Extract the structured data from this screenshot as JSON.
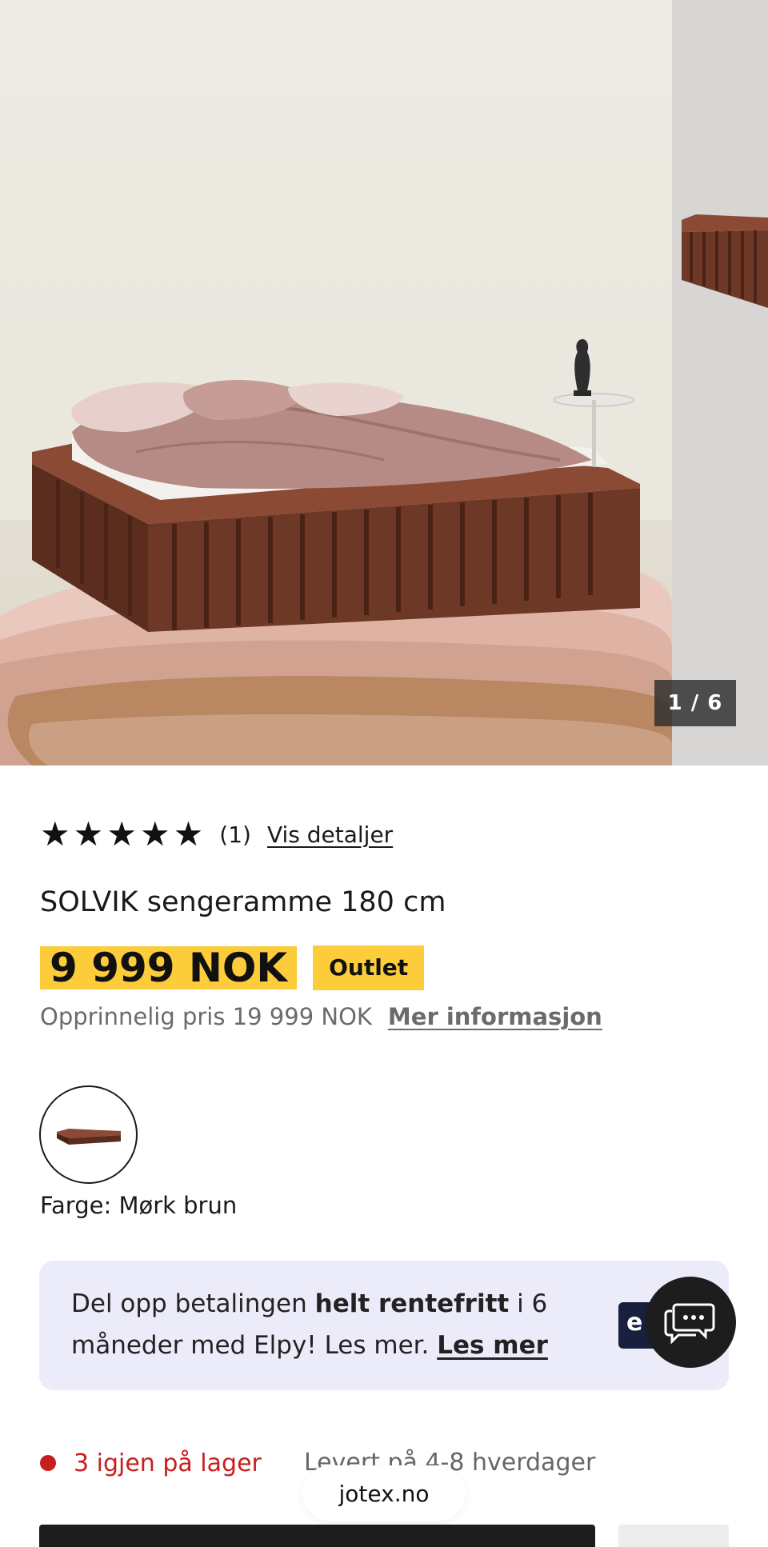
{
  "gallery": {
    "counter": "1 / 6"
  },
  "rating": {
    "stars": [
      "★",
      "★",
      "★",
      "★",
      "★"
    ],
    "count": "(1)",
    "details_link": "Vis detaljer"
  },
  "product": {
    "title": "SOLVIK sengeramme 180 cm",
    "price": "9 999 NOK",
    "badge": "Outlet",
    "original_price": "Opprinnelig pris 19 999 NOK",
    "more_info_link": "Mer informasjon",
    "color_label": "Farge: Mørk brun"
  },
  "payment": {
    "text_before": "Del opp betalingen ",
    "text_bold": "helt rentefritt",
    "text_after": " i 6 måneder med Elpy! Les mer. ",
    "link": "Les mer",
    "logo_letter": "e"
  },
  "stock": {
    "status": "3 igjen på lager",
    "delivery": "Levert på 4-8 hverdager"
  },
  "browser": {
    "url": "jotex.no"
  },
  "colors": {
    "highlight": "#fccc3a",
    "stock_red": "#c81e1e",
    "payment_bg": "#ebebfa",
    "dark": "#1d1d1d"
  },
  "icons": {
    "chat": "chat-bubbles-icon",
    "stock": "red-dot-icon"
  }
}
